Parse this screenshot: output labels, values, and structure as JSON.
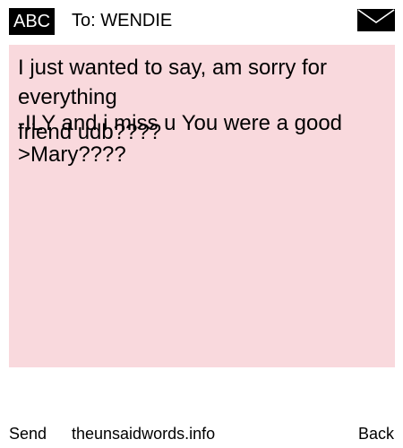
{
  "header": {
    "input_mode": "ABC",
    "recipient": "To: WENDIE",
    "envelope_icon": "envelope-icon"
  },
  "message": {
    "background_color": "#f9d9dd",
    "lines": [
      "I just wanted to say, am sorry for",
      "everything",
      "friend udb????",
      "-ILY and i miss u You were a good",
      ">Mary????"
    ]
  },
  "footer": {
    "send_label": "Send",
    "site_label": "theunsaidwords.info",
    "back_label": "Back"
  }
}
